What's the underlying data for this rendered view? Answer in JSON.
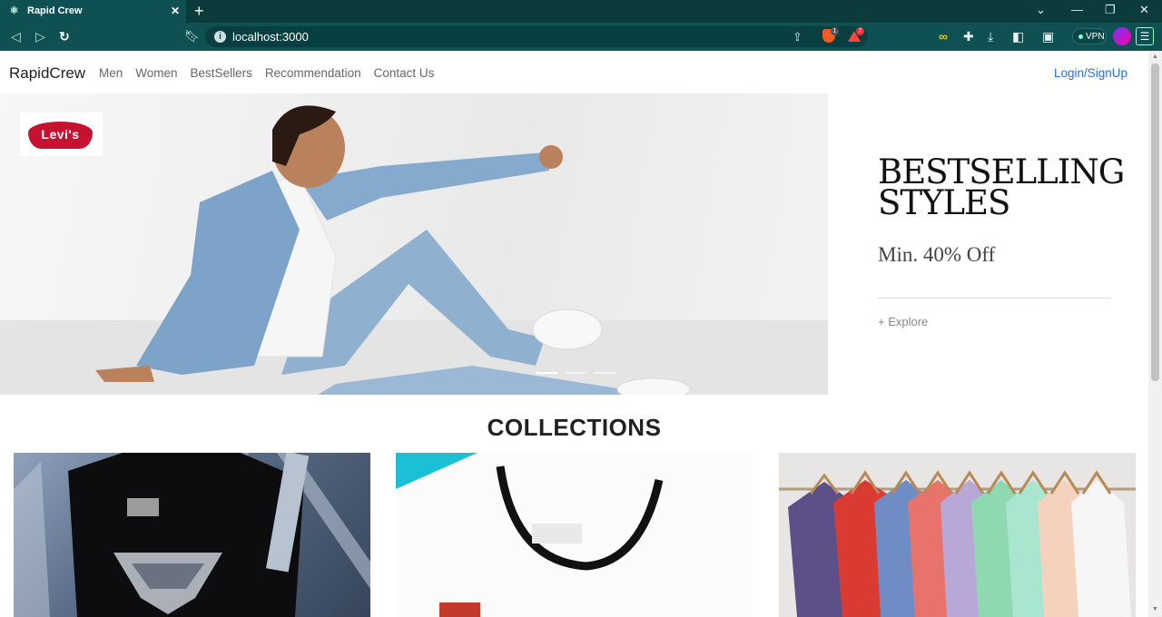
{
  "browser": {
    "tab_title": "Rapid Crew",
    "url": "localhost:3000",
    "brave_badge": "1",
    "rewards_badge": "7",
    "vpn_label": "VPN"
  },
  "navbar": {
    "brand": "RapidCrew",
    "links": [
      "Men",
      "Women",
      "BestSellers",
      "Recommendation",
      "Contact Us"
    ],
    "login": "Login/SignUp"
  },
  "hero": {
    "logo_text": "Levi's",
    "title": "BESTSELLING STYLES",
    "subtitle": "Min. 40% Off",
    "cta": "+ Explore",
    "slides": 3,
    "active_slide": 1
  },
  "collections": {
    "title": "COLLECTIONS",
    "cards": [
      "superman-tee",
      "white-ringer-tee",
      "hanging-tees"
    ]
  },
  "colors": {
    "chrome_dark": "#0c3b3c",
    "chrome_toolbar": "#0f5153",
    "link_blue": "#2b6fd6",
    "levis_red": "#c41230"
  }
}
